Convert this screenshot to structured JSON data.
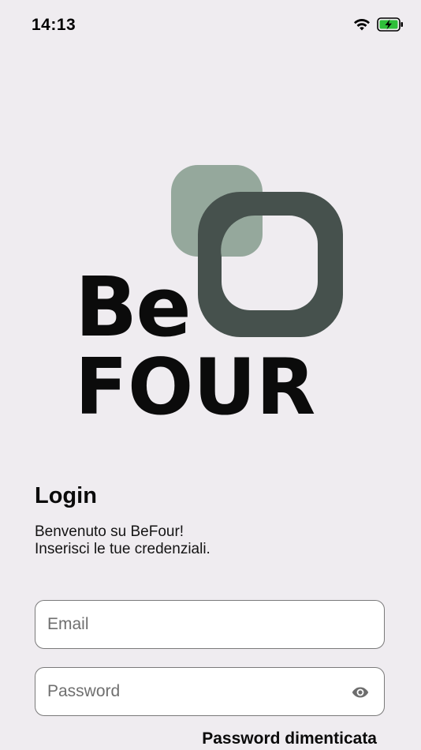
{
  "status_bar": {
    "time": "14:13",
    "wifi_icon": "wifi-icon",
    "battery_icon": "battery-charging-icon",
    "battery_color": "#2fbf3a"
  },
  "logo": {
    "line1": "Be",
    "line2": "FOUR",
    "color_light": "#95a89c",
    "color_dark": "#46514d"
  },
  "login": {
    "title": "Login",
    "welcome_line1": "Benvenuto su BeFour!",
    "welcome_line2": "Inserisci le tue credenziali."
  },
  "form": {
    "email_placeholder": "Email",
    "password_placeholder": "Password",
    "password_toggle_icon": "eye-icon",
    "forgot_password": "Password dimenticata"
  }
}
